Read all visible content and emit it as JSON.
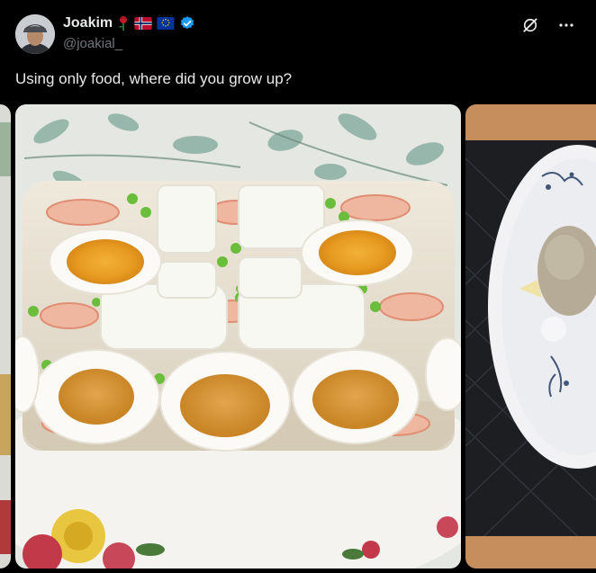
{
  "author": {
    "display_name": "Joakim",
    "handle": "@joakial_",
    "badges": [
      "rose-icon",
      "norway-flag-icon",
      "eu-flag-icon",
      "verified-icon"
    ]
  },
  "tweet": {
    "text": "Using only food, where did you grow up?"
  },
  "actions": [
    "grok-icon",
    "more-icon"
  ],
  "media": {
    "images": [
      "egg-and-shrimp-aspic",
      "plate-with-meatball"
    ]
  },
  "colors": {
    "background": "#000000",
    "text": "#e7e9ea",
    "secondary_text": "#71767b",
    "verified": "#1d9bf0"
  }
}
